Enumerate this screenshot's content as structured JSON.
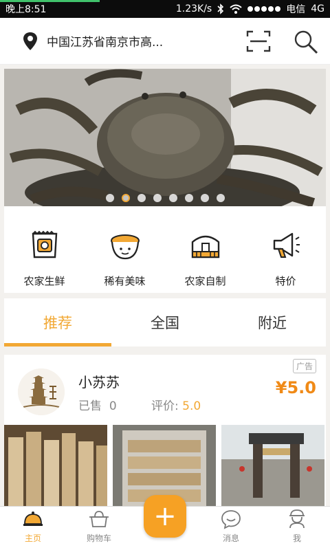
{
  "status": {
    "time": "晚上8:51",
    "speed": "1.23K/s",
    "carrier": "电信",
    "network": "4G"
  },
  "header": {
    "location": "中国江苏省南京市高...",
    "location_icon": "map-pin-icon",
    "scan_icon": "scan-icon",
    "search_icon": "search-icon"
  },
  "banner": {
    "slide_count": 8,
    "active_index": 1
  },
  "categories": [
    {
      "label": "农家生鲜",
      "icon": "fresh-produce-icon"
    },
    {
      "label": "稀有美味",
      "icon": "rare-delicacy-icon"
    },
    {
      "label": "农家自制",
      "icon": "farmhouse-icon"
    },
    {
      "label": "特价",
      "icon": "megaphone-icon"
    }
  ],
  "tabs": [
    {
      "label": "推荐",
      "active": true
    },
    {
      "label": "全国",
      "active": false
    },
    {
      "label": "附近",
      "active": false
    }
  ],
  "store": {
    "name": "小苏苏",
    "sold_label": "已售",
    "sold_count": "0",
    "rating_label": "评价:",
    "rating_value": "5.0",
    "ad_label": "广告",
    "price": "¥5.0"
  },
  "bottom_nav": [
    {
      "label": "主页",
      "icon": "home-cloche-icon",
      "active": true
    },
    {
      "label": "购物车",
      "icon": "cart-pot-icon",
      "active": false
    },
    {
      "label": "消息",
      "icon": "message-icon",
      "active": false
    },
    {
      "label": "我",
      "icon": "profile-icon",
      "active": false
    }
  ],
  "fab": {
    "label": "+"
  },
  "colors": {
    "accent": "#f2a834",
    "price": "#f08a17"
  }
}
